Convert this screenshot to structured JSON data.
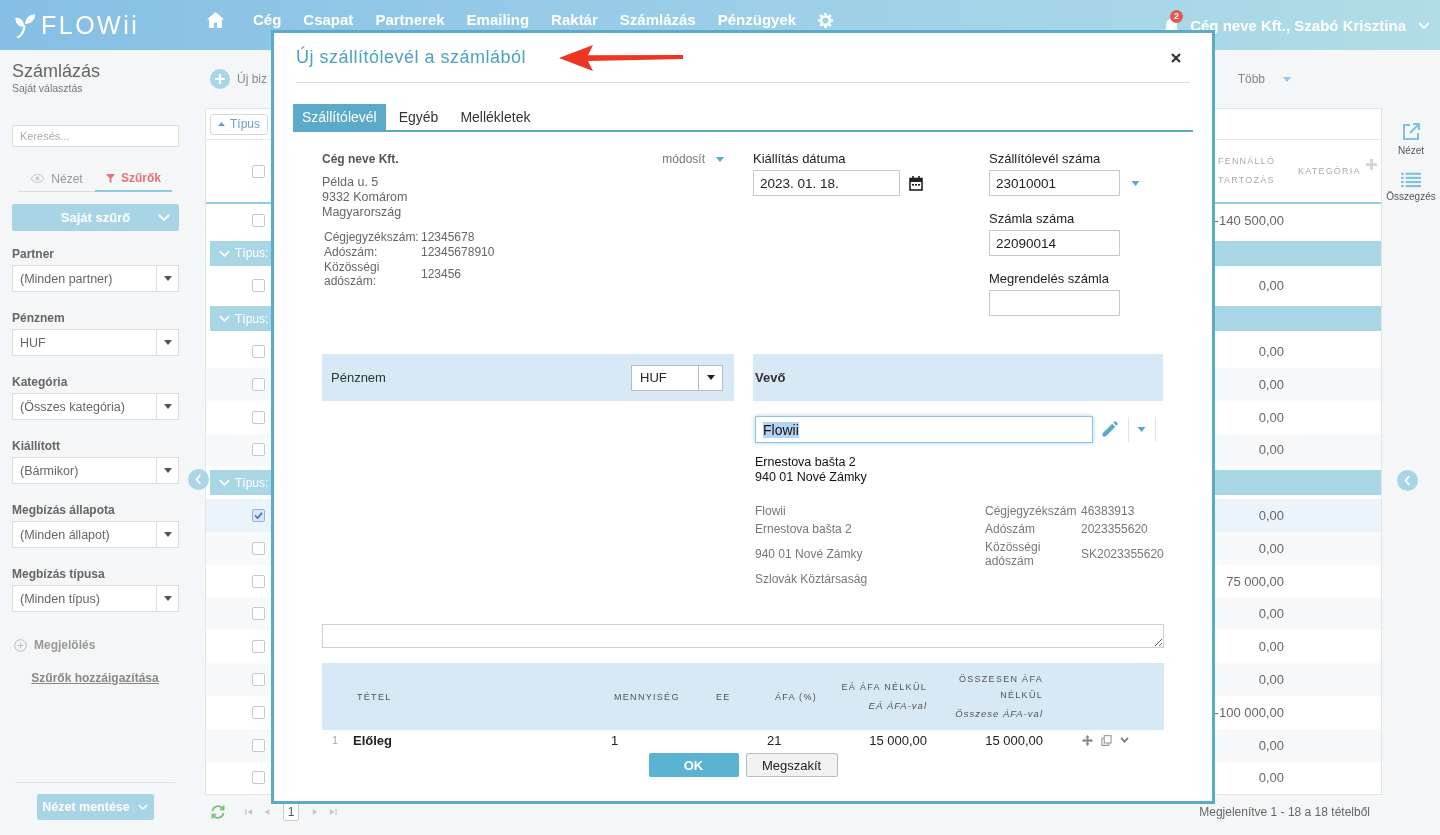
{
  "nav": {
    "logo": "FLOWii",
    "items": [
      {
        "label": "Cég"
      },
      {
        "label": "Csapat"
      },
      {
        "label": "Partnerek"
      },
      {
        "label": "Emailing"
      },
      {
        "label": "Raktár"
      },
      {
        "label": "Számlázás"
      },
      {
        "label": "Pénzügyek"
      }
    ],
    "notifications": "2",
    "user": "Cég neve Kft., Szabó Krisztina"
  },
  "page_header": {
    "title": "Számlázás",
    "subtitle": "Saját választás",
    "new_button": "Új biz",
    "more_menu": "Több"
  },
  "sidebar": {
    "search": {
      "placeholder": "Keresés..."
    },
    "tabs": [
      {
        "label": "Nézet",
        "selected": false
      },
      {
        "label": "Szűrők",
        "selected": true
      }
    ],
    "saved_filter": "Saját szűrő",
    "filters": [
      {
        "label": "Partner",
        "value": "(Minden partner)"
      },
      {
        "label": "Pénznem",
        "value": "HUF"
      },
      {
        "label": "Kategória",
        "value": "(Összes kategória)"
      },
      {
        "label": "Kiállított",
        "value": "(Bármikor)"
      },
      {
        "label": "Megbízás állapota",
        "value": "(Minden állapot)"
      },
      {
        "label": "Megbízás típusa",
        "value": "(Minden típus)"
      }
    ],
    "mark_button": "Megjelölés",
    "adjust_link": "Szűrők hozzáigazítása",
    "save_view_button": "Nézet mentése"
  },
  "table": {
    "group_by": "Típus",
    "select_all": {
      "checked": false
    },
    "columns": [
      {
        "label": "FENNÁLLÓ TARTOZÁS"
      },
      {
        "label": "KATEGÓRIA"
      }
    ],
    "rows": [
      {
        "kind": "item",
        "checked": false,
        "selected": false,
        "outstanding": "-140 500,00"
      },
      {
        "kind": "group",
        "label": "Típus:"
      },
      {
        "kind": "item",
        "checked": false,
        "selected": false,
        "outstanding": "0,00"
      },
      {
        "kind": "group",
        "label": "Típus:"
      },
      {
        "kind": "item",
        "checked": false,
        "selected": false,
        "outstanding": "0,00"
      },
      {
        "kind": "item",
        "checked": false,
        "selected": false,
        "outstanding": "0,00"
      },
      {
        "kind": "item",
        "checked": false,
        "selected": false,
        "outstanding": "0,00"
      },
      {
        "kind": "item",
        "checked": false,
        "selected": false,
        "outstanding": "0,00"
      },
      {
        "kind": "group",
        "label": "Típus:"
      },
      {
        "kind": "item",
        "checked": true,
        "selected": true,
        "outstanding": "0,00"
      },
      {
        "kind": "item",
        "checked": false,
        "selected": false,
        "outstanding": "0,00"
      },
      {
        "kind": "item",
        "checked": false,
        "selected": false,
        "outstanding": "75 000,00"
      },
      {
        "kind": "item",
        "checked": false,
        "selected": false,
        "outstanding": "0,00"
      },
      {
        "kind": "item",
        "checked": false,
        "selected": false,
        "outstanding": "0,00"
      },
      {
        "kind": "item",
        "checked": false,
        "selected": false,
        "outstanding": "0,00"
      },
      {
        "kind": "item",
        "checked": false,
        "selected": false,
        "outstanding": "-100 000,00"
      },
      {
        "kind": "item",
        "checked": false,
        "selected": false,
        "outstanding": "0,00"
      },
      {
        "kind": "item",
        "checked": false,
        "selected": false,
        "outstanding": "0,00"
      }
    ]
  },
  "pagination": {
    "page": "1",
    "summary": "Megjelenítve 1 - 18 a 18 tételből"
  },
  "right_rail": [
    {
      "label": "Nézet",
      "kind": "popout"
    },
    {
      "label": "Összegzés",
      "kind": "summary"
    }
  ],
  "modal": {
    "title": "Új szállítólevél a számlából",
    "tabs": [
      {
        "label": "Szállítólevél",
        "selected": true
      },
      {
        "label": "Egyéb",
        "selected": false
      },
      {
        "label": "Mellékletek",
        "selected": false
      }
    ],
    "seller": {
      "name": "Cég neve Kft.",
      "edit_link": "módosít",
      "address": [
        "Példa u. 5",
        "9332 Komárom",
        "Magyarország"
      ],
      "ids": [
        {
          "label": "Cégjegyzékszám:",
          "value": "12345678"
        },
        {
          "label": "Adószám:",
          "value": "12345678910"
        },
        {
          "label": "Közösségi adószám:",
          "value": "123456"
        }
      ]
    },
    "issue_date": {
      "label": "Kiállítás dátuma",
      "value": "2023. 01. 18."
    },
    "delivery_note_number": {
      "label": "Szállítólevél száma",
      "value": "23010001"
    },
    "invoice_number": {
      "label": "Számla száma",
      "value": "22090014"
    },
    "order_invoice": {
      "label": "Megrendelés számla"
    },
    "currency": {
      "label": "Pénznem",
      "value": "HUF"
    },
    "buyer": {
      "heading": "Vevő",
      "name_field": {
        "value": "Flowii",
        "focused": true
      },
      "address": [
        "Ernestova bašta 2",
        "940 01 Nové Zámky"
      ],
      "details": [
        "Flowii",
        "Ernestova bašta 2",
        "940 01 Nové Zámky",
        "Szlovák Köztársaság"
      ],
      "ids": [
        {
          "label": "Cégjegyzékszám",
          "value": "46383913"
        },
        {
          "label": "Adószám",
          "value": "2023355620"
        },
        {
          "label": "Közösségi adószám",
          "value": "SK2023355620"
        }
      ]
    },
    "items": {
      "columns": [
        {
          "label": "TÉTEL"
        },
        {
          "label": "MENNYISÉG"
        },
        {
          "label": "EE"
        },
        {
          "label": "ÁFA (%)"
        },
        {
          "label": "EÁ ÁFA NÉLKÜL",
          "sublabel": "EÁ ÁFA-val"
        },
        {
          "label": "ÖSSZESEN ÁFA NÉLKÜL",
          "sublabel": "Összese ÁFA-val"
        }
      ],
      "rows": [
        {
          "number": "1",
          "item": "Előleg",
          "quantity": "1",
          "vat": "21",
          "unit_net": "15 000,00",
          "total_net": "15 000,00"
        }
      ]
    },
    "buttons": [
      {
        "label": "OK",
        "kind": "primary"
      },
      {
        "label": "Megszakít",
        "kind": "secondary"
      }
    ]
  }
}
